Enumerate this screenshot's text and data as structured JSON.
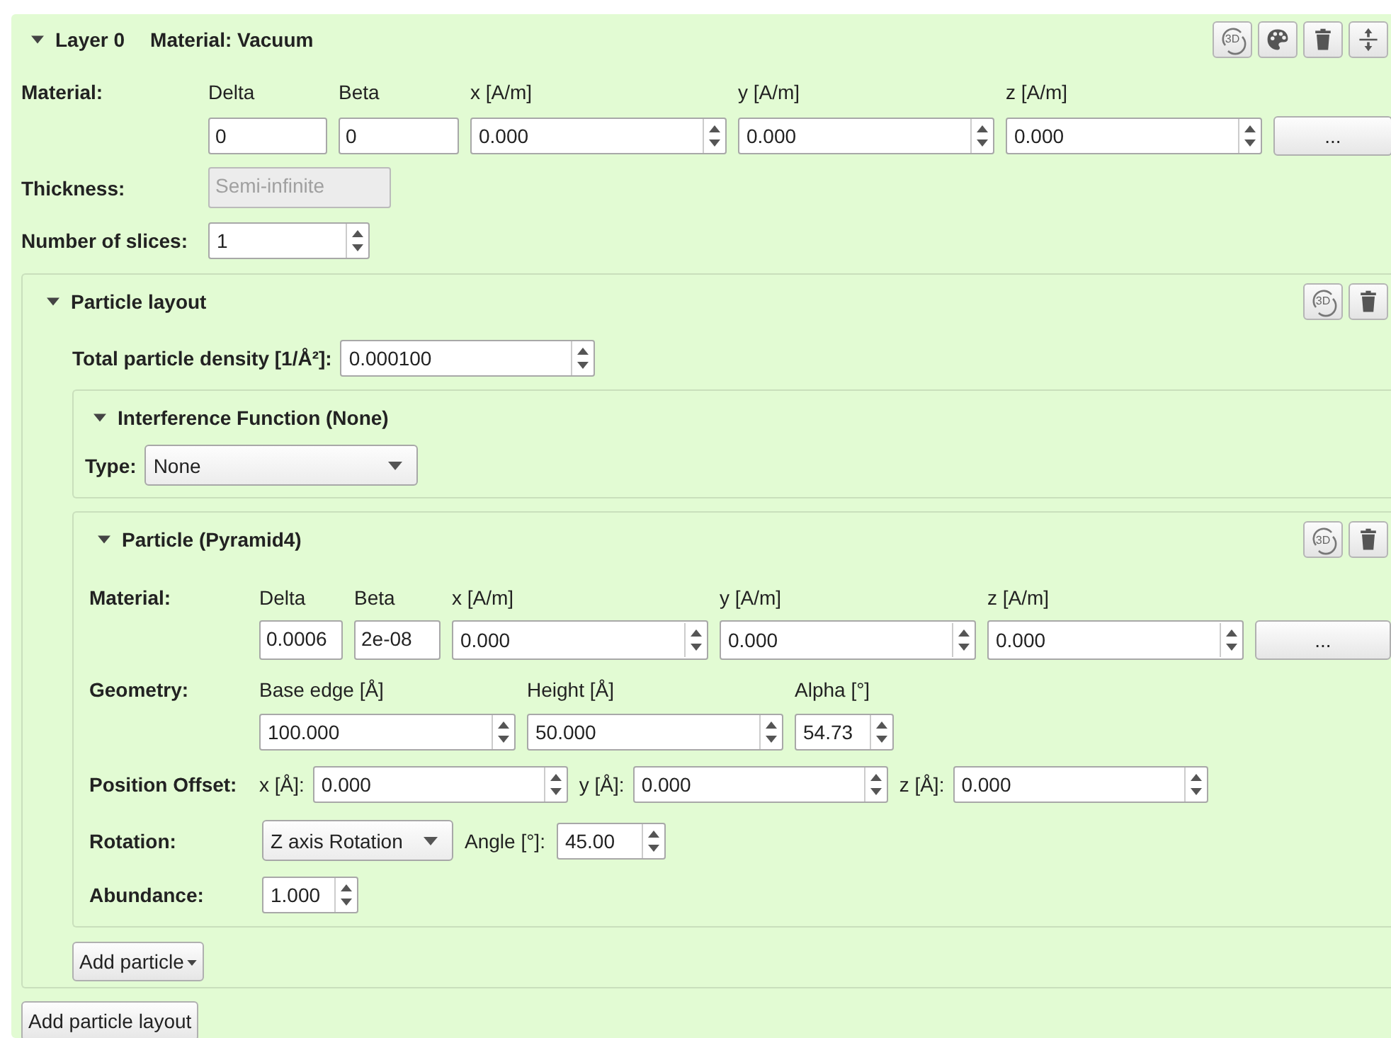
{
  "layer": {
    "title": "Layer 0",
    "subtitle": "Material: Vacuum",
    "expanded": true,
    "tools": [
      {
        "kind": "rotate",
        "label": "3D"
      },
      {
        "kind": "palette"
      },
      {
        "kind": "delete"
      },
      {
        "kind": "move"
      }
    ],
    "material": {
      "label": "Material:",
      "fields": [
        {
          "header": "Delta",
          "value": "0",
          "kind": "text"
        },
        {
          "header": "Beta",
          "value": "0",
          "kind": "text"
        },
        {
          "header": "x [A/m]",
          "value": "0.000",
          "kind": "spin"
        },
        {
          "header": "y [A/m]",
          "value": "0.000",
          "kind": "spin"
        },
        {
          "header": "z [A/m]",
          "value": "0.000",
          "kind": "spin"
        }
      ],
      "more_button": "..."
    },
    "thickness": {
      "label": "Thickness:",
      "value": "Semi-infinite",
      "disabled": true
    },
    "slices": {
      "label": "Number of slices:",
      "value": "1"
    },
    "layouts": [
      {
        "title": "Particle layout",
        "expanded": true,
        "tools": [
          {
            "kind": "rotate",
            "label": "3D"
          },
          {
            "kind": "delete"
          }
        ],
        "density": {
          "label": "Total particle density [1/Å²]:",
          "value": "0.000100"
        },
        "interference": {
          "title": "Interference Function (None)",
          "expanded": true,
          "type_label": "Type:",
          "type_value": "None"
        },
        "particles": [
          {
            "title": "Particle (Pyramid4)",
            "expanded": true,
            "tools": [
              {
                "kind": "rotate",
                "label": "3D"
              },
              {
                "kind": "delete"
              }
            ],
            "material": {
              "label": "Material:",
              "fields": [
                {
                  "header": "Delta",
                  "value": "0.0006",
                  "kind": "text"
                },
                {
                  "header": "Beta",
                  "value": "2e-08",
                  "kind": "text"
                },
                {
                  "header": "x [A/m]",
                  "value": "0.000",
                  "kind": "spin"
                },
                {
                  "header": "y [A/m]",
                  "value": "0.000",
                  "kind": "spin"
                },
                {
                  "header": "z [A/m]",
                  "value": "0.000",
                  "kind": "spin"
                }
              ],
              "more_button": "..."
            },
            "geometry": {
              "label": "Geometry:",
              "fields": [
                {
                  "header": "Base edge [Å]",
                  "value": "100.000",
                  "kind": "spin"
                },
                {
                  "header": "Height [Å]",
                  "value": "50.000",
                  "kind": "spin"
                },
                {
                  "header": "Alpha [°]",
                  "value": "54.73",
                  "kind": "spin"
                }
              ]
            },
            "position": {
              "label": "Position Offset:",
              "fields": [
                {
                  "label": "x [Å]:",
                  "value": "0.000",
                  "kind": "spin"
                },
                {
                  "label": "y [Å]:",
                  "value": "0.000",
                  "kind": "spin"
                },
                {
                  "label": "z [Å]:",
                  "value": "0.000",
                  "kind": "spin"
                }
              ]
            },
            "rotation": {
              "label": "Rotation:",
              "type": "Z axis Rotation",
              "angle_label": "Angle [°]:",
              "angle": "45.00"
            },
            "abundance": {
              "label": "Abundance:",
              "value": "1.000"
            }
          }
        ],
        "add_particle": "Add particle"
      }
    ],
    "add_layout": "Add particle layout"
  }
}
